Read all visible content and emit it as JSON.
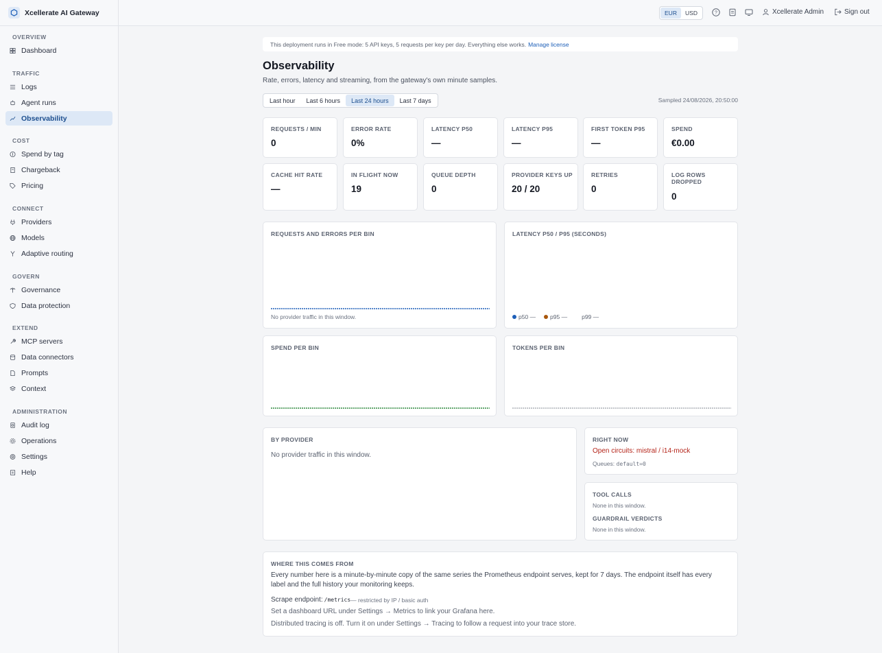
{
  "brand": {
    "name": "Xcellerate AI Gateway"
  },
  "sidebar": {
    "sections": [
      {
        "title": "OVERVIEW",
        "items": [
          {
            "label": "Dashboard",
            "icon": "dashboard-icon"
          }
        ]
      },
      {
        "title": "TRAFFIC",
        "items": [
          {
            "label": "Logs",
            "icon": "logs-icon"
          },
          {
            "label": "Agent runs",
            "icon": "agent-runs-icon"
          },
          {
            "label": "Observability",
            "icon": "chart-icon",
            "active": true
          }
        ]
      },
      {
        "title": "COST",
        "items": [
          {
            "label": "Spend by tag",
            "icon": "dollar-icon"
          },
          {
            "label": "Chargeback",
            "icon": "receipt-icon"
          },
          {
            "label": "Pricing",
            "icon": "tag-icon"
          }
        ]
      },
      {
        "title": "CONNECT",
        "items": [
          {
            "label": "Providers",
            "icon": "plug-icon"
          },
          {
            "label": "Models",
            "icon": "globe-icon"
          },
          {
            "label": "Adaptive routing",
            "icon": "routing-icon"
          }
        ]
      },
      {
        "title": "GOVERN",
        "items": [
          {
            "label": "Governance",
            "icon": "scale-icon"
          },
          {
            "label": "Data protection",
            "icon": "shield-icon"
          }
        ]
      },
      {
        "title": "EXTEND",
        "items": [
          {
            "label": "MCP servers",
            "icon": "wrench-icon"
          },
          {
            "label": "Data connectors",
            "icon": "database-icon"
          },
          {
            "label": "Prompts",
            "icon": "document-icon"
          },
          {
            "label": "Context",
            "icon": "layers-icon"
          }
        ]
      },
      {
        "title": "ADMINISTRATION",
        "items": [
          {
            "label": "Audit log",
            "icon": "audit-icon"
          },
          {
            "label": "Operations",
            "icon": "cog-icon"
          },
          {
            "label": "Settings",
            "icon": "settings-icon"
          },
          {
            "label": "Help",
            "icon": "help-icon"
          }
        ]
      }
    ]
  },
  "topbar": {
    "currency": {
      "options": [
        "EUR",
        "USD"
      ],
      "selected": "EUR"
    },
    "user": "Xcellerate Admin",
    "signout": "Sign out"
  },
  "license": {
    "text": "This deployment runs in Free mode: 5 API keys, 5 requests per key per day. Everything else works.",
    "link": "Manage license"
  },
  "page": {
    "title": "Observability",
    "subtitle": "Rate, errors, latency and streaming, from the gateway's own minute samples.",
    "ranges": [
      "Last hour",
      "Last 6 hours",
      "Last 24 hours",
      "Last 7 days"
    ],
    "selected_range": "Last 24 hours",
    "sampled": "Sampled 24/08/2026, 20:50:00"
  },
  "stats_row1": [
    {
      "label": "REQUESTS / MIN",
      "value": "0"
    },
    {
      "label": "ERROR RATE",
      "value": "0%"
    },
    {
      "label": "LATENCY P50",
      "value": "—"
    },
    {
      "label": "LATENCY P95",
      "value": "—"
    },
    {
      "label": "FIRST TOKEN P95",
      "value": "—"
    },
    {
      "label": "SPEND",
      "value": "€0.00"
    }
  ],
  "stats_row2": [
    {
      "label": "CACHE HIT RATE",
      "value": "—"
    },
    {
      "label": "IN FLIGHT NOW",
      "value": "19"
    },
    {
      "label": "QUEUE DEPTH",
      "value": "0"
    },
    {
      "label": "PROVIDER KEYS UP",
      "value": "20 / 20"
    },
    {
      "label": "RETRIES",
      "value": "0"
    },
    {
      "label": "LOG ROWS DROPPED",
      "value": "0"
    }
  ],
  "charts": {
    "requests": {
      "title": "REQUESTS AND ERRORS PER BIN",
      "empty": "No provider traffic in this window.",
      "color": "#1d5fb8"
    },
    "latency": {
      "title": "LATENCY P50 / P95 (SECONDS)",
      "legend": [
        {
          "label": "p50 —",
          "color": "#1d5fb8"
        },
        {
          "label": "p95 —",
          "color": "#a8570c"
        },
        {
          "label": "p99 —",
          "color": ""
        }
      ]
    },
    "spend": {
      "title": "SPEND PER BIN",
      "color": "#2e8a3e"
    },
    "tokens": {
      "title": "TOKENS PER BIN",
      "color": "#9aa0a8"
    }
  },
  "chart_data": [
    {
      "type": "bar",
      "title": "REQUESTS AND ERRORS PER BIN",
      "values": []
    },
    {
      "type": "line",
      "title": "LATENCY P50 / P95 (SECONDS)",
      "series": [
        {
          "name": "p50",
          "values": []
        },
        {
          "name": "p95",
          "values": []
        },
        {
          "name": "p99",
          "values": []
        }
      ]
    },
    {
      "type": "bar",
      "title": "SPEND PER BIN",
      "values": []
    },
    {
      "type": "bar",
      "title": "TOKENS PER BIN",
      "values": []
    }
  ],
  "by_provider": {
    "title": "BY PROVIDER",
    "empty": "No provider traffic in this window."
  },
  "right_now": {
    "title": "RIGHT NOW",
    "alert": "Open circuits: mistral / i14-mock",
    "alert_color": "#b42318",
    "queues_label": "Queues:",
    "queues_value": "default=0"
  },
  "tool_calls": {
    "title": "TOOL CALLS",
    "empty": "None in this window.",
    "guardrail_title": "GUARDRAIL VERDICTS",
    "guardrail_empty": "None in this window."
  },
  "source": {
    "title": "WHERE THIS COMES FROM",
    "para": "Every number here is a minute-by-minute copy of the same series the Prometheus endpoint serves, kept for 7 days. The endpoint itself has every label and the full history your monitoring keeps.",
    "scrape_label": "Scrape endpoint:",
    "scrape_path": "/metrics",
    "scrape_note": "— restricted by IP / basic auth",
    "grafana": "Set a dashboard URL under Settings → Metrics to link your Grafana here.",
    "tracing": "Distributed tracing is off. Turn it on under Settings → Tracing to follow a request into your trace store."
  }
}
